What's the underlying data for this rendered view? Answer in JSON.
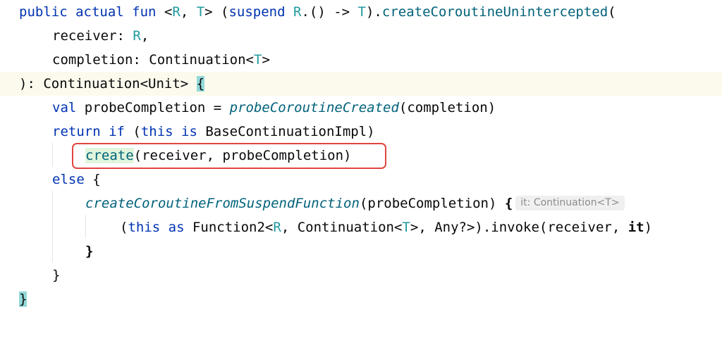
{
  "code": {
    "l1": {
      "kw1": "public actual fun ",
      "p1": "<",
      "t1": "R",
      "p2": ", ",
      "t2": "T",
      "p3": "> (",
      "kw2": "suspend ",
      "t3": "R",
      "p4": ".() -> ",
      "t4": "T",
      "p5": ").",
      "fn": "createCoroutineUnintercepted",
      "p6": "("
    },
    "l2": {
      "name": "receiver: ",
      "type": "R",
      "tail": ","
    },
    "l3": {
      "name": "completion: Continuation<",
      "type": "T",
      "tail": ">"
    },
    "l4": {
      "text": "): Continuation<Unit> ",
      "brace": "{"
    },
    "l5": {
      "kw": "val ",
      "a": "probeCompletion = ",
      "fn": "probeCoroutineCreated",
      "b": "(completion)"
    },
    "l6": {
      "kw1": "return if ",
      "a": "(",
      "kw2": "this is ",
      "b": "BaseContinuationImpl)"
    },
    "l7": {
      "fn": "create",
      "rest": "(receiver, probeCompletion)"
    },
    "l8": {
      "kw": "else ",
      "brace": "{"
    },
    "l9": {
      "fn": "createCoroutineFromSuspendFunction",
      "a": "(probeCompletion) ",
      "brace": "{",
      "hint": "it: Continuation<T>"
    },
    "l10": {
      "p1": "(",
      "kw1": "this ",
      "kw2": "as ",
      "a": "Function2<",
      "t1": "R",
      "b": ", Continuation<",
      "t2": "T",
      "c": ">, Any?>).invoke(receiver, ",
      "it": "it",
      "d": ")"
    },
    "l11": {
      "brace": "}"
    },
    "l12": {
      "brace": "}"
    },
    "l13": {
      "brace": "}"
    }
  },
  "colors": {
    "keyword": "#0033b3",
    "type_param": "#20999d",
    "function": "#00627a",
    "highlight_box": "#e0453f",
    "current_line": "#fcfaed"
  }
}
